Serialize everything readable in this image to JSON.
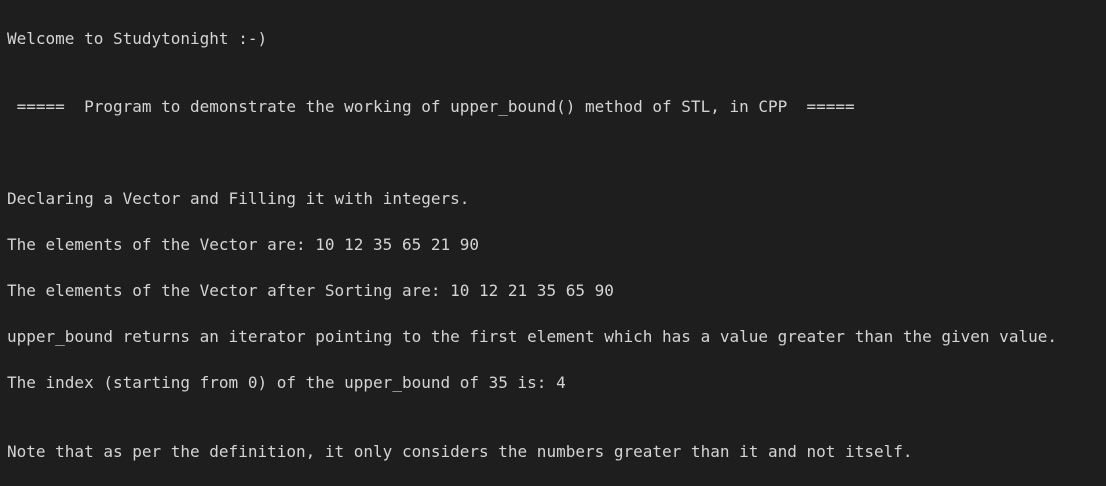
{
  "terminal": {
    "lines": [
      "Welcome to Studytonight :-)",
      " =====  Program to demonstrate the working of upper_bound() method of STL, in CPP  =====",
      "Declaring a Vector and Filling it with integers.",
      "The elements of the Vector are: 10 12 35 65 21 90",
      "The elements of the Vector after Sorting are: 10 12 21 35 65 90",
      "upper_bound returns an iterator pointing to the first element which has a value greater than the given value.",
      "The index (starting from 0) of the upper_bound of 35 is: 4",
      "Note that as per the definition, it only considers the numbers greater than it and not itself."
    ]
  },
  "colors": {
    "background": "#1e1e1e",
    "text": "#d4d4d4"
  }
}
